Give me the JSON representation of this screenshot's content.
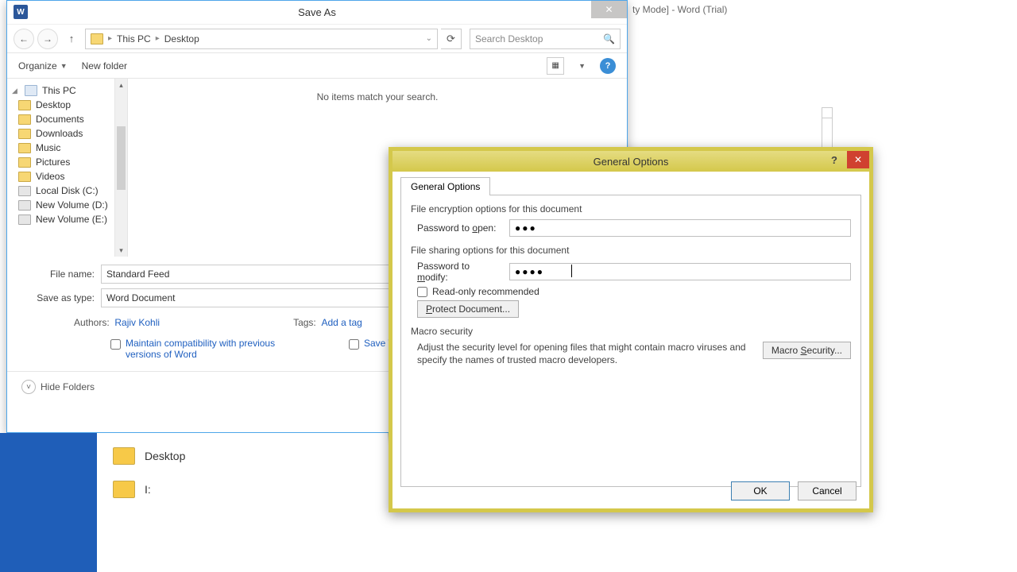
{
  "word": {
    "title_suffix": "ty Mode] - Word (Trial)"
  },
  "saveas": {
    "title": "Save As",
    "icon_letter": "W",
    "nav": {
      "back": "←",
      "fwd": "→",
      "up": "↑"
    },
    "breadcrumb": {
      "seg1": "This PC",
      "seg2": "Desktop"
    },
    "search_placeholder": "Search Desktop",
    "toolbar": {
      "organize": "Organize",
      "newfolder": "New folder"
    },
    "tree": {
      "root": "This PC",
      "items": [
        "Desktop",
        "Documents",
        "Downloads",
        "Music",
        "Pictures",
        "Videos",
        "Local Disk (C:)",
        "New Volume (D:)",
        "New Volume (E:)"
      ]
    },
    "content_empty": "No items match your search.",
    "filename_label": "File name:",
    "filename_value": "Standard Feed",
    "type_label": "Save as type:",
    "type_value": "Word Document",
    "authors_label": "Authors:",
    "authors_value": "Rajiv Kohli",
    "tags_label": "Tags:",
    "tags_value": "Add a tag",
    "maintain_label": "Maintain compatibility with previous versions of Word",
    "thumb_label": "Save Thumbnail",
    "hide_folders": "Hide Folders"
  },
  "jumplist": {
    "items": [
      "Desktop",
      "I:"
    ]
  },
  "genopt": {
    "title": "General Options",
    "tab": "General Options",
    "encrypt_heading": "File encryption options for this document",
    "open_label_pre": "Password to ",
    "open_label_u": "o",
    "open_label_post": "pen:",
    "open_value": "●●●",
    "share_heading": "File sharing options for this document",
    "modify_label_pre": "Password to ",
    "modify_label_u": "m",
    "modify_label_post": "odify:",
    "modify_value": "●●●●",
    "readonly_label": "Read-only recommended",
    "protect_btn_u": "P",
    "protect_btn_rest": "rotect Document...",
    "macro_heading": "Macro security",
    "macro_text": "Adjust the security level for opening files that might contain macro viruses and specify the names of trusted macro developers.",
    "macro_btn_pre": "Macro ",
    "macro_btn_u": "S",
    "macro_btn_post": "ecurity...",
    "ok": "OK",
    "cancel": "Cancel"
  }
}
